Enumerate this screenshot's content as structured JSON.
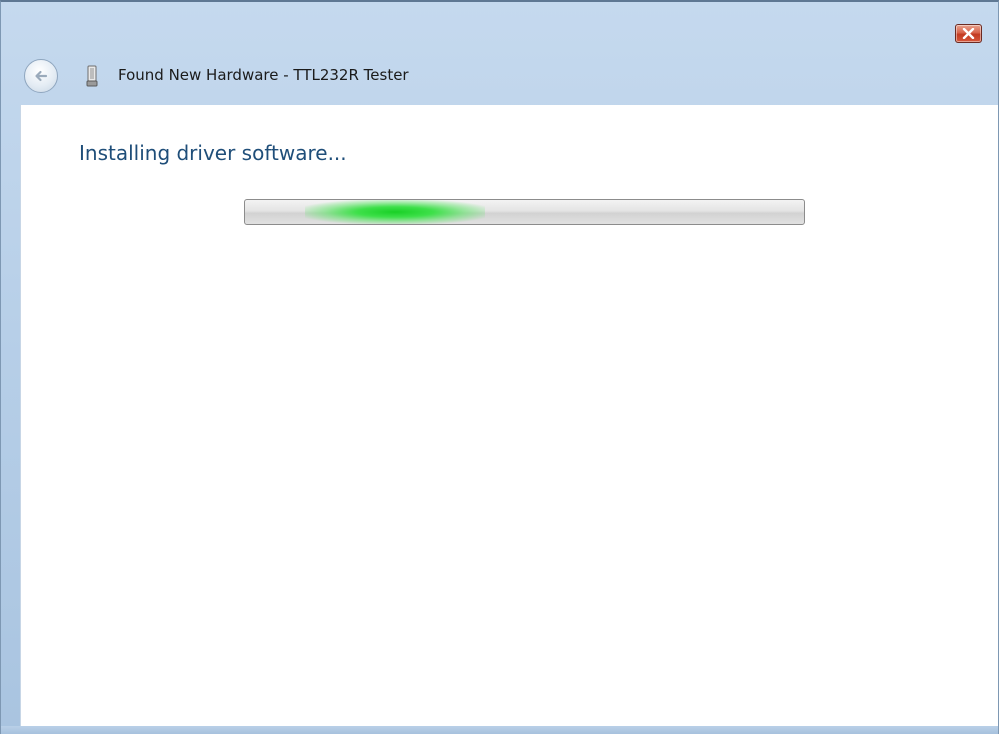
{
  "window": {
    "title": "Found New Hardware - TTL232R Tester",
    "icons": {
      "back": "back-arrow-icon",
      "device": "usb-device-icon",
      "close": "close-icon"
    }
  },
  "main": {
    "heading": "Installing driver software...",
    "progress": {
      "mode": "indeterminate",
      "color": "#19d026"
    }
  },
  "colors": {
    "heading": "#1f4e79",
    "titlebar": "#b7cfe8",
    "close_button": "#c23b22"
  }
}
